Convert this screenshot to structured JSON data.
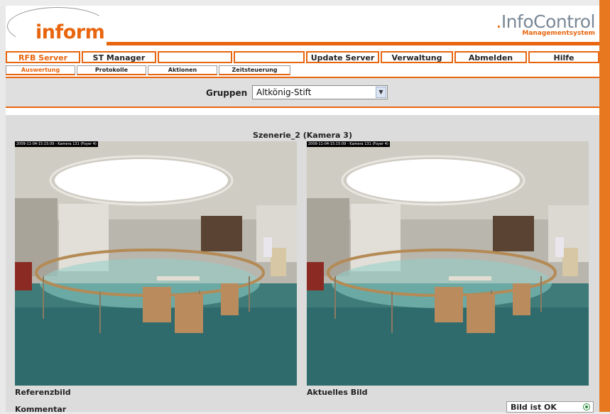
{
  "logo": {
    "text": "inform"
  },
  "brand": {
    "name_prefix": ".",
    "name": "InfoControl",
    "subtitle": "Managementsystem"
  },
  "nav": {
    "items": [
      {
        "label": "RFB Server",
        "active": true
      },
      {
        "label": "ST Manager",
        "active": false
      },
      {
        "label": "",
        "active": false
      },
      {
        "label": "",
        "active": false
      },
      {
        "label": "Update Server",
        "active": false
      },
      {
        "label": "Verwaltung",
        "active": false
      },
      {
        "label": "Abmelden",
        "active": false
      },
      {
        "label": "Hilfe",
        "active": false
      }
    ]
  },
  "subnav": {
    "items": [
      {
        "label": "Auswertung",
        "active": true
      },
      {
        "label": "Protokolle",
        "active": false
      },
      {
        "label": "Aktionen",
        "active": false
      },
      {
        "label": "Zeitsteuerung",
        "active": false
      }
    ]
  },
  "filter": {
    "label": "Gruppen",
    "selected": "Altkönig-Stift"
  },
  "scene": {
    "title": "Szenerie_2 (Kamera 3)"
  },
  "images": {
    "reference": {
      "caption": "Referenzbild",
      "stamp": "2009-11-04-15:15:09 - Kamera 131 (Foyer 4)"
    },
    "current": {
      "caption": "Aktuelles Bild",
      "stamp": "2009-11-04-15:15:09 - Kamera 131 (Foyer 4)"
    }
  },
  "comment": {
    "label": "Kommentar"
  },
  "status": {
    "label": "Bild ist OK",
    "selected": true
  },
  "colors": {
    "accent": "#e8650f",
    "band": "#dfdfdf",
    "content_bg": "#dcdcdc"
  }
}
